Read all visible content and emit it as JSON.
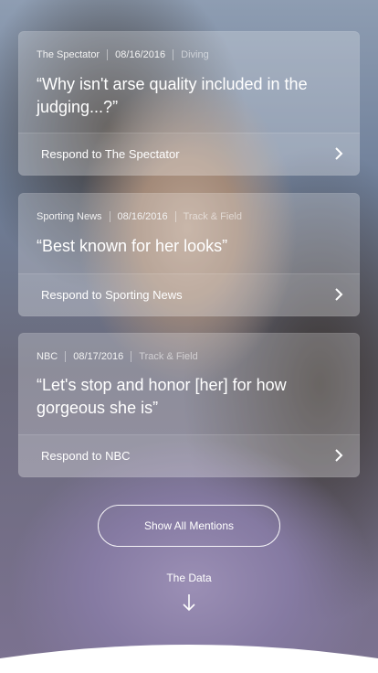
{
  "mentions": [
    {
      "source": "The Spectator",
      "date": "08/16/2016",
      "category": "Diving",
      "quote": "“Why isn't arse quality included in the judging...?”",
      "respond": "Respond to The Spectator"
    },
    {
      "source": "Sporting News",
      "date": "08/16/2016",
      "category": "Track & Field",
      "quote": "“Best known for her looks”",
      "respond": "Respond to Sporting News"
    },
    {
      "source": "NBC",
      "date": "08/17/2016",
      "category": "Track & Field",
      "quote": "“Let's stop and honor [her] for how gorgeous she is”",
      "respond": "Respond to NBC"
    }
  ],
  "show_all_label": "Show All Mentions",
  "data_label": "The Data",
  "icons": {
    "respond": "chevron-right-icon",
    "scroll": "arrow-down-icon"
  },
  "colors": {
    "card_bg": "#ffffff3d",
    "text": "#ffffff"
  }
}
